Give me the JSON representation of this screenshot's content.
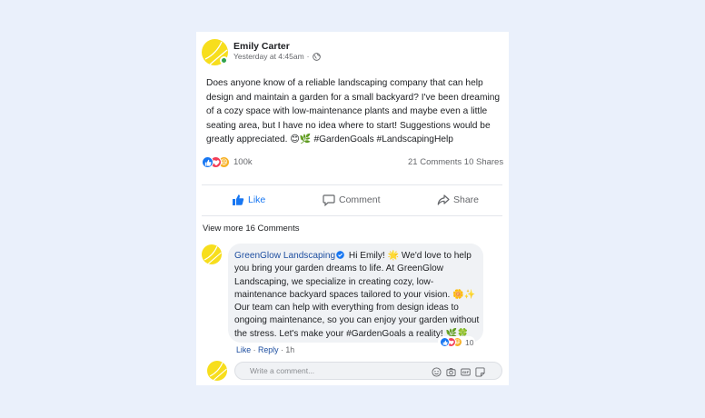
{
  "post": {
    "author": "Emily Carter",
    "timestamp": "Yesterday at 4:45am",
    "separator": "·",
    "privacy_icon": "globe-icon",
    "body": "Does anyone know of a reliable landscaping company that can help design and maintain a garden for a small backyard? I've been dreaming of a cozy space with low-maintenance plants and maybe even a little seating area, but I have no idea where to start! Suggestions would be greatly appreciated. 😊🌿 #GardenGoals #LandscapingHelp",
    "reactions": [
      "like-icon",
      "love-icon",
      "haha-icon"
    ],
    "reaction_count": "100k",
    "comments_count": "21 Comments",
    "shares_count": "10 Shares"
  },
  "actions": {
    "like": "Like",
    "comment": "Comment",
    "share": "Share"
  },
  "comments": {
    "view_more": "View more 16 Comments",
    "items": [
      {
        "author": "GreenGlow Landscaping",
        "verified": true,
        "text": "Hi Emily! 🌟 We'd love to help you bring your garden dreams to life. At GreenGlow Landscaping, we specialize in creating cozy, low-maintenance backyard spaces tailored to your vision. 🌼✨ Our team can help with everything from design ideas to ongoing maintenance, so you can enjoy your garden without the stress. Let's make your #GardenGoals a reality! 🌿🍀",
        "reaction_count": "10",
        "like_label": "Like",
        "dot": "·",
        "reply_label": "Reply",
        "time": "1h"
      }
    ]
  },
  "composer": {
    "placeholder": "Write a comment...",
    "icons": [
      "emoji-icon",
      "camera-icon",
      "gif-icon",
      "sticker-icon"
    ]
  },
  "colors": {
    "accent": "#1877f2",
    "background": "#eaf0fb",
    "avatar": "#f7de1d",
    "link": "#1d4ea0"
  }
}
